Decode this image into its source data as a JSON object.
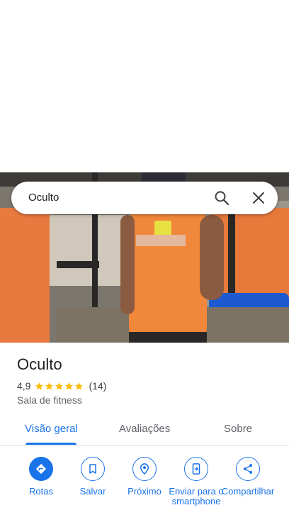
{
  "search": {
    "query": "Oculto"
  },
  "place": {
    "name": "Oculto",
    "rating": "4,9",
    "stars": 5,
    "review_count": "(14)",
    "category": "Sala de fitness"
  },
  "tabs": [
    {
      "label": "Visão geral",
      "active": true
    },
    {
      "label": "Avaliações",
      "active": false
    },
    {
      "label": "Sobre",
      "active": false
    }
  ],
  "actions": [
    {
      "label": "Rotas",
      "icon": "directions-icon"
    },
    {
      "label": "Salvar",
      "icon": "bookmark-icon"
    },
    {
      "label": "Próximo",
      "icon": "nearby-icon"
    },
    {
      "label": "Enviar para o smartphone",
      "icon": "send-to-phone-icon"
    },
    {
      "label": "Compartilhar",
      "icon": "share-icon"
    }
  ],
  "colors": {
    "accent": "#1a73e8",
    "star": "#fbbc04",
    "text_primary": "#202124",
    "text_secondary": "#5f6368"
  }
}
